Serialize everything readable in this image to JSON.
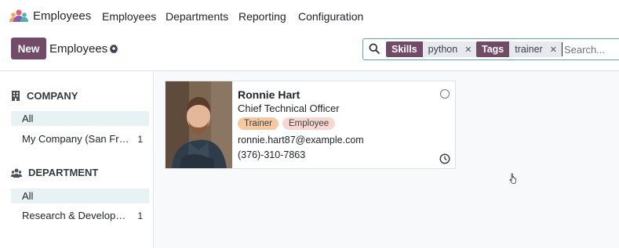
{
  "app": {
    "name": "Employees"
  },
  "nav": {
    "items": [
      {
        "label": "Employees"
      },
      {
        "label": "Departments"
      },
      {
        "label": "Reporting"
      },
      {
        "label": "Configuration"
      }
    ]
  },
  "control": {
    "new_label": "New",
    "title": "Employees"
  },
  "search": {
    "facets": [
      {
        "name": "Skills",
        "value": "python"
      },
      {
        "name": "Tags",
        "value": "trainer"
      }
    ],
    "placeholder": "Search..."
  },
  "sidepanel": {
    "sections": [
      {
        "title": "COMPANY",
        "icon": "building-icon",
        "items": [
          {
            "label": "All",
            "active": true
          },
          {
            "label": "My Company (San Francisco)",
            "count": "1"
          }
        ]
      },
      {
        "title": "DEPARTMENT",
        "icon": "users-icon",
        "items": [
          {
            "label": "All",
            "active": true
          },
          {
            "label": "Research & Development",
            "count": "1"
          }
        ]
      }
    ]
  },
  "card": {
    "name": "Ronnie Hart",
    "job": "Chief Technical Officer",
    "tags": [
      "Trainer",
      "Employee"
    ],
    "email": "ronnie.hart87@example.com",
    "phone": "(376)-310-7863"
  },
  "colors": {
    "brand": "#714B67",
    "accent_border": "#5fa8a8",
    "active_bg": "#e6f2f3",
    "tag_trainer": "#f6c99f",
    "tag_employee": "#f8d7cf"
  }
}
